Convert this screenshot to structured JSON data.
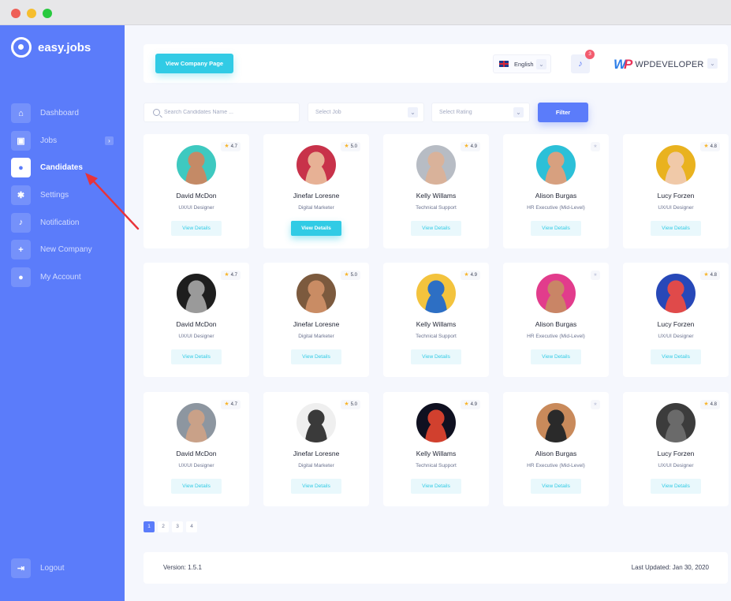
{
  "app": {
    "name": "easy.jobs"
  },
  "sidebar": {
    "items": [
      {
        "label": "Dashboard",
        "icon": "home-icon"
      },
      {
        "label": "Jobs",
        "icon": "briefcase-icon"
      },
      {
        "label": "Candidates",
        "icon": "user-card-icon",
        "active": true
      },
      {
        "label": "Settings",
        "icon": "gear-icon"
      },
      {
        "label": "Notification",
        "icon": "bell-icon"
      },
      {
        "label": "New Company",
        "icon": "plus-icon"
      },
      {
        "label": "My Account",
        "icon": "user-icon"
      }
    ],
    "logout_label": "Logout"
  },
  "topbar": {
    "view_company_label": "View Company Page",
    "language": "English",
    "notification_count": "3",
    "brand_text": "WPDEVELOPER"
  },
  "filters": {
    "search_placeholder": "Search Candidates Name ...",
    "job_placeholder": "Select Job",
    "rating_placeholder": "Select Rating",
    "filter_label": "Filter"
  },
  "candidates": [
    {
      "name": "David McDon",
      "role": "UX/UI Designer",
      "rating": "4.7",
      "button": "View Details",
      "avatar_bg": "#3ec9c0",
      "avatar_skin": "#c48a66"
    },
    {
      "name": "Jinefar Loresne",
      "role": "Digital Marketer",
      "rating": "5.0",
      "button": "View Details",
      "avatar_bg": "#c8324a",
      "avatar_skin": "#e7b195"
    },
    {
      "name": "Kelly Willams",
      "role": "Technical Support",
      "rating": "4.9",
      "button": "View Details",
      "avatar_bg": "#b7bcc4",
      "avatar_skin": "#d9b29a"
    },
    {
      "name": "Alison Burgas",
      "role": "HR Executive (Mid-Level)",
      "rating": "",
      "button": "View Details",
      "avatar_bg": "#2cc0d8",
      "avatar_skin": "#d7a07f"
    },
    {
      "name": "Lucy Forzen",
      "role": "UX/UI Designer",
      "rating": "4.8",
      "button": "View Details",
      "avatar_bg": "#e9b21f",
      "avatar_skin": "#f0c9a8"
    },
    {
      "name": "David McDon",
      "role": "UX/UI Designer",
      "rating": "4.7",
      "button": "View Details",
      "avatar_bg": "#1e1e1e",
      "avatar_skin": "#9a9a9a"
    },
    {
      "name": "Jinefar Loresne",
      "role": "Digital Marketer",
      "rating": "5.0",
      "button": "View Details",
      "avatar_bg": "#7c5a3e",
      "avatar_skin": "#c98c64"
    },
    {
      "name": "Kelly Willams",
      "role": "Technical Support",
      "rating": "4.9",
      "button": "View Details",
      "avatar_bg": "#f3c33d",
      "avatar_skin": "#2d6fc4"
    },
    {
      "name": "Alison Burgas",
      "role": "HR Executive (Mid-Level)",
      "rating": "",
      "button": "View Details",
      "avatar_bg": "#e23c8c",
      "avatar_skin": "#c98566"
    },
    {
      "name": "Lucy Forzen",
      "role": "UX/UI Designer",
      "rating": "4.8",
      "button": "View Details",
      "avatar_bg": "#2748b8",
      "avatar_skin": "#e04a4a"
    },
    {
      "name": "David McDon",
      "role": "UX/UI Designer",
      "rating": "4.7",
      "button": "View Details",
      "avatar_bg": "#8d96a0",
      "avatar_skin": "#c9a188"
    },
    {
      "name": "Jinefar Loresne",
      "role": "Digital Marketer",
      "rating": "5.0",
      "button": "View Details",
      "avatar_bg": "#efefef",
      "avatar_skin": "#3a3a3a"
    },
    {
      "name": "Kelly Willams",
      "role": "Technical Support",
      "rating": "4.9",
      "button": "View Details",
      "avatar_bg": "#0f1020",
      "avatar_skin": "#d1402e"
    },
    {
      "name": "Alison Burgas",
      "role": "HR Executive (Mid-Level)",
      "rating": "",
      "button": "View Details",
      "avatar_bg": "#c98a5b",
      "avatar_skin": "#2a2a2a"
    },
    {
      "name": "Lucy Forzen",
      "role": "UX/UI Designer",
      "rating": "4.8",
      "button": "View Details",
      "avatar_bg": "#3c3c3c",
      "avatar_skin": "#6a6a6a"
    }
  ],
  "pagination": {
    "pages": [
      "1",
      "2",
      "3",
      "4"
    ],
    "current": "1",
    "prev": "‹",
    "next": "›"
  },
  "footer": {
    "version": "Version: 1.5.1",
    "last_updated": "Last Updated: Jan 30, 2020"
  },
  "colors": {
    "sidebar": "#5b7cfa",
    "accent": "#31cbe5",
    "primary": "#5b7cfa",
    "star": "#f7b52c",
    "annotation_arrow": "#e8333a"
  }
}
